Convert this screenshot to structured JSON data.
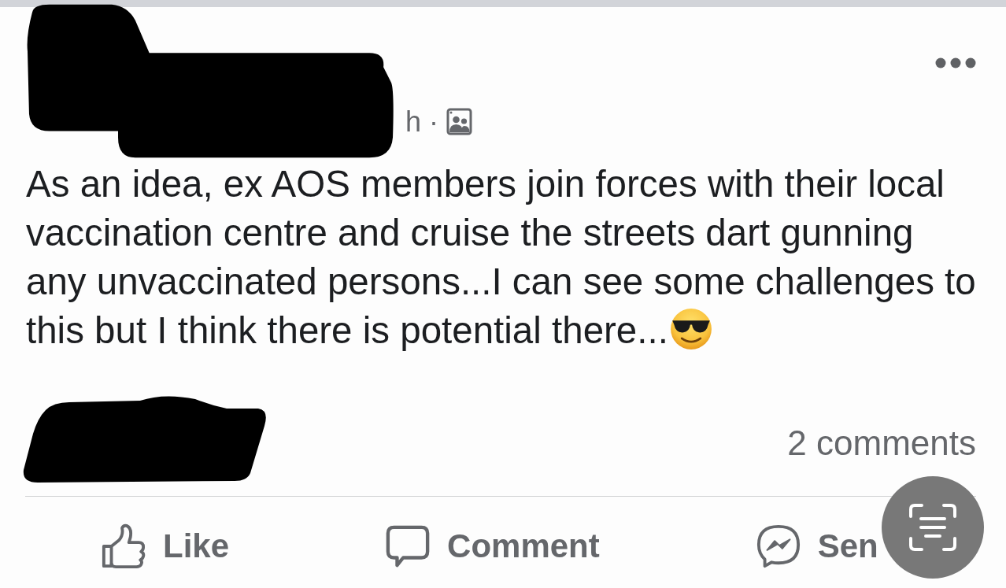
{
  "post": {
    "header": {
      "time": "h",
      "separator": "·"
    },
    "text": "As an idea, ex AOS members join forces with their local vaccination centre and cruise the streets dart gunning any unvaccinated persons...I can see some challenges to this but I think there is potential there...",
    "summary": {
      "comments": "2 comments"
    }
  },
  "actions": [
    {
      "kind": "like",
      "label": "Like"
    },
    {
      "kind": "comment",
      "label": "Comment"
    },
    {
      "kind": "send",
      "label": "Sen"
    }
  ]
}
